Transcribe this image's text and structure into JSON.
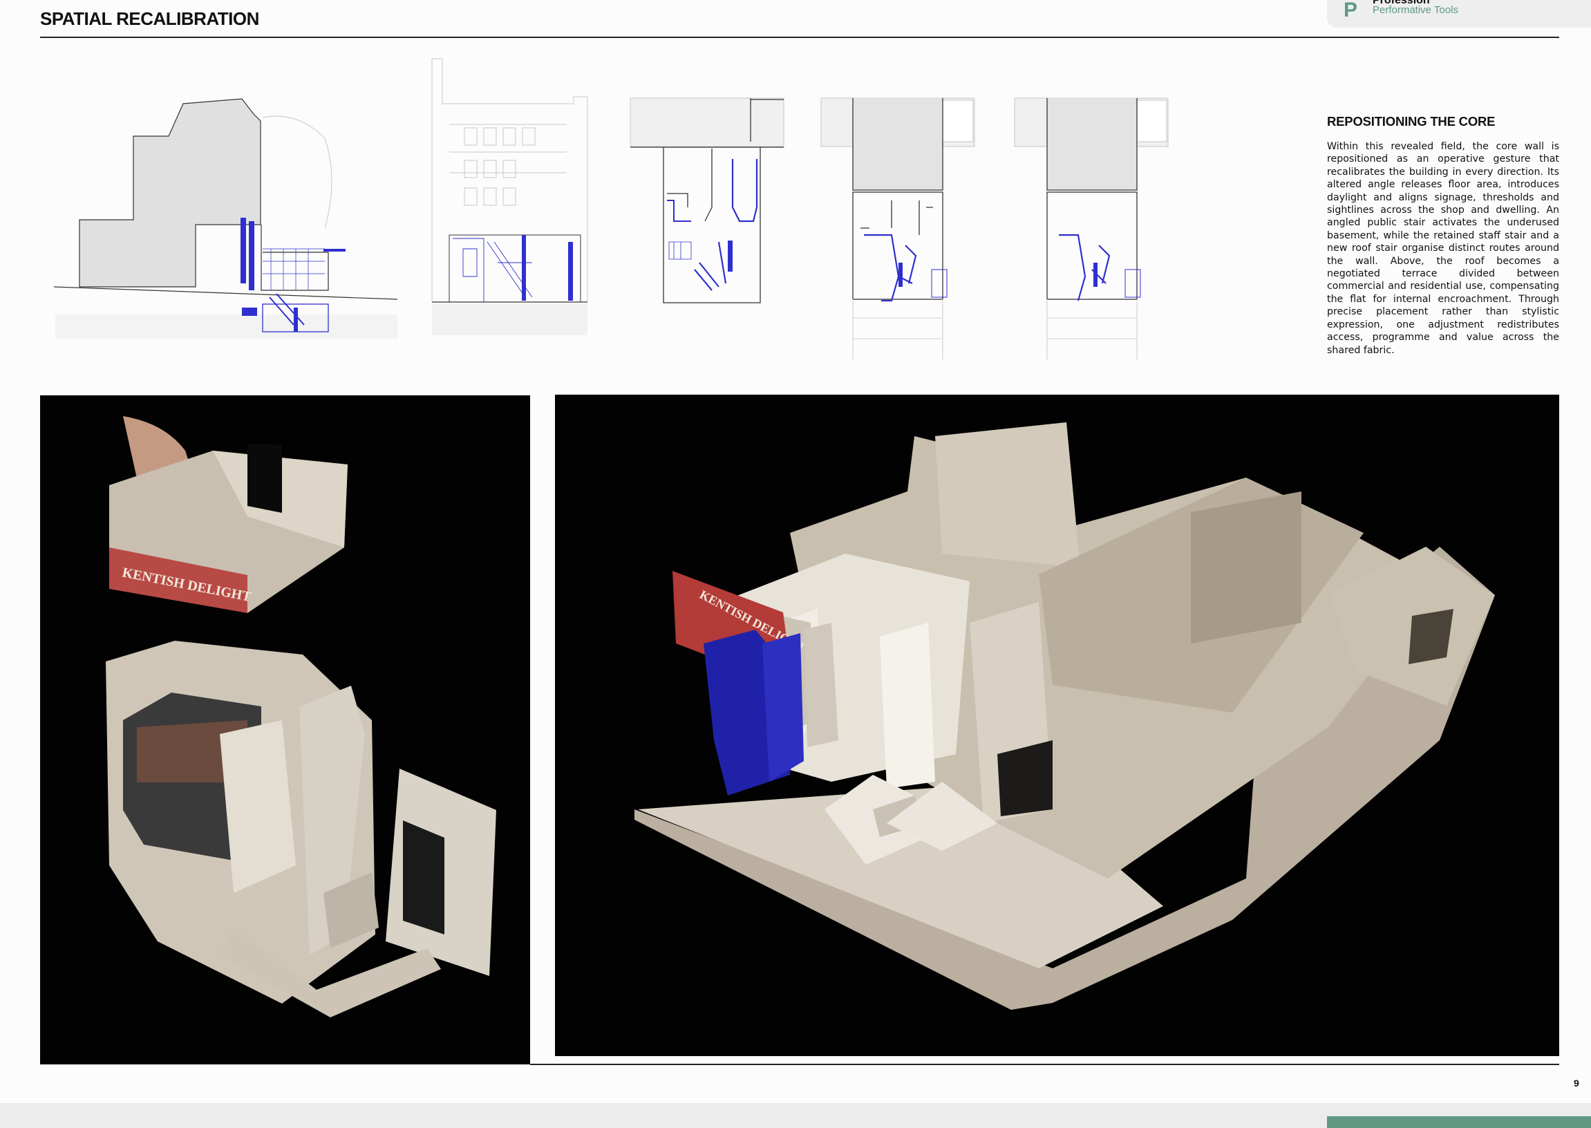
{
  "page": {
    "title": "SPATIAL RECALIBRATION",
    "page_number": "9"
  },
  "tool_tab": {
    "logo_letter": "P",
    "brand": "Profession",
    "subtitle": "Performative Tools"
  },
  "text_block": {
    "heading": "REPOSITIONING THE CORE",
    "body": "Within this revealed field, the core wall is repositioned as an operative gesture that recalibrates the building in every direction. Its altered angle releases floor area, introduces daylight and aligns signage, thresholds and sightlines across the shop and dwelling. An angled public stair activates the underused basement, while the retained staff stair and a new roof stair organise distinct routes around the wall. Above, the roof becomes a negotiated terrace divided between commercial and residential use, compensating the flat for internal encroachment. Through precise placement rather than stylistic expression, one adjustment redistributes access, programme and value across the shared fabric."
  },
  "photos": {
    "left_sign": "KENTISH DELIGHT",
    "right_sign": "KENTISH DELIGHT"
  },
  "colors": {
    "accent_blue": "#2f2fd0",
    "brand_green": "#5f9984",
    "model_board": "#cfc4b3",
    "photo_background": "#020202"
  }
}
